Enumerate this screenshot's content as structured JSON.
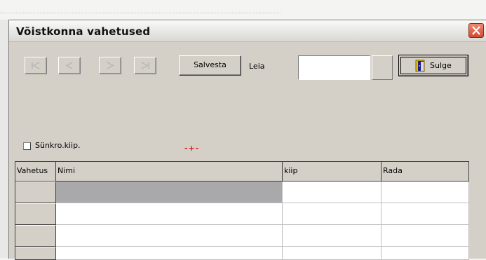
{
  "window": {
    "title": "Võistkonna vahetused"
  },
  "toolbar": {
    "nav_buttons": [
      "first-record-icon",
      "previous-record-icon",
      "next-record-icon",
      "last-record-icon"
    ],
    "save_label": "Salvesta",
    "search_label": "Leia",
    "search_value": "",
    "close_label": "Sulge"
  },
  "options": {
    "sync_checkbox_label": "Sünkro.kiip.",
    "sync_checked": false
  },
  "grid": {
    "columns": [
      "Vahetus",
      "Nimi",
      "kiip",
      "Rada"
    ],
    "rows": [
      [
        "",
        "",
        "",
        ""
      ],
      [
        "",
        "",
        "",
        ""
      ],
      [
        "",
        "",
        "",
        ""
      ],
      [
        "",
        "",
        "",
        ""
      ]
    ]
  },
  "colors": {
    "window_bg": "#d4d0c8",
    "selected_cell": "#a9a9ac",
    "close_button": "#d04a30"
  }
}
